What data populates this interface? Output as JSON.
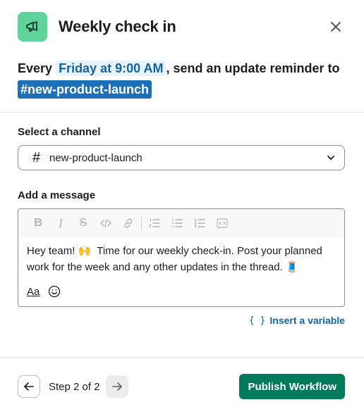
{
  "header": {
    "title": "Weekly check in",
    "icon": "megaphone-icon",
    "icon_bg": "#5fd39a"
  },
  "summary": {
    "prefix": "Every",
    "time": "Friday at 9:00 AM",
    "middle": ", send an update reminder to",
    "channel": "#new-product-launch"
  },
  "channel_field": {
    "label": "Select a channel",
    "hash": "#",
    "value": "new-product-launch"
  },
  "message_field": {
    "label": "Add a message",
    "text_before": "Hey team!",
    "emoji1": "🙌",
    "text_after": "Time for our weekly check-in. Post your planned work for the week and any other updates in the thread.",
    "emoji2": "🧵",
    "format_label": "Aa"
  },
  "insert_variable": {
    "braces": "{ }",
    "label": "Insert a variable"
  },
  "footer": {
    "step_text": "Step 2 of 2",
    "publish_label": "Publish Workflow"
  },
  "colors": {
    "accent": "#1264a3",
    "channel_chip": "#1d6fb8",
    "publish": "#007a5a"
  }
}
